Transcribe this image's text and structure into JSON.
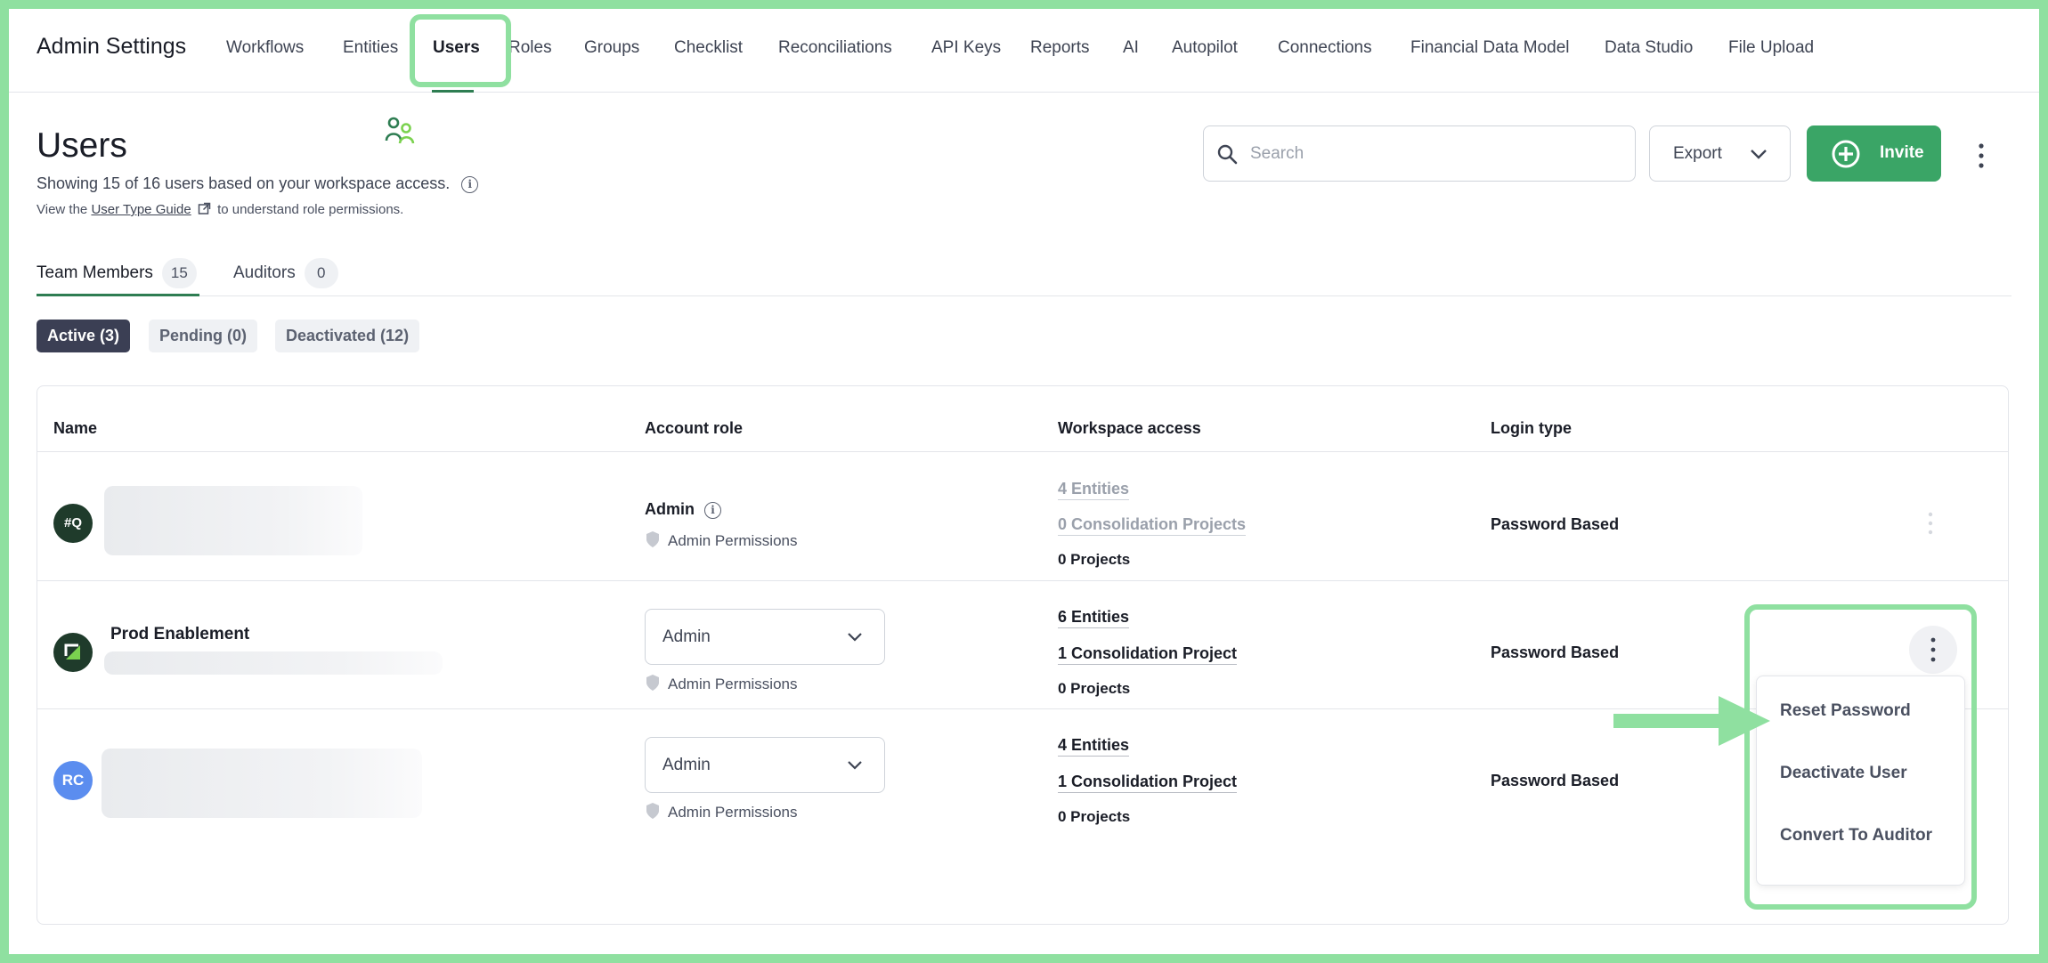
{
  "app": {
    "title": "Admin Settings"
  },
  "nav": {
    "tabs": [
      {
        "label": "Workflows"
      },
      {
        "label": "Entities"
      },
      {
        "label": "Users",
        "active": true
      },
      {
        "label": "Roles"
      },
      {
        "label": "Groups"
      },
      {
        "label": "Checklist"
      },
      {
        "label": "Reconciliations"
      },
      {
        "label": "API Keys"
      },
      {
        "label": "Reports"
      },
      {
        "label": "AI"
      },
      {
        "label": "Autopilot"
      },
      {
        "label": "Connections"
      },
      {
        "label": "Financial Data Model"
      },
      {
        "label": "Data Studio"
      },
      {
        "label": "File Upload"
      }
    ]
  },
  "page": {
    "title": "Users",
    "subtitle": "Showing 15 of 16 users based on your workspace access.",
    "guide_prefix": "View the",
    "guide_link": "User Type Guide",
    "guide_suffix": "to understand role permissions."
  },
  "search": {
    "placeholder": "Search",
    "value": ""
  },
  "actions": {
    "export_label": "Export",
    "invite_label": "Invite"
  },
  "tabs": [
    {
      "label": "Team Members",
      "count": "15",
      "active": true
    },
    {
      "label": "Auditors",
      "count": "0"
    }
  ],
  "filters": [
    {
      "label": "Active (3)",
      "active": true
    },
    {
      "label": "Pending (0)"
    },
    {
      "label": "Deactivated (12)"
    }
  ],
  "table": {
    "headers": {
      "name": "Name",
      "role": "Account role",
      "workspace": "Workspace access",
      "login": "Login type"
    },
    "rows": [
      {
        "avatar": "#Q",
        "avatar_color": "#1f3b2b",
        "name": "",
        "role": "Admin",
        "permissions": "Admin Permissions",
        "entities": "4 Entities",
        "consolidation": "0 Consolidation Projects",
        "projects": "0 Projects",
        "login": "Password Based"
      },
      {
        "avatar": "",
        "avatar_color": "#1f3b2b",
        "name": "Prod Enablement",
        "role": "Admin",
        "permissions": "Admin Permissions",
        "entities": "6 Entities",
        "consolidation": "1 Consolidation Project",
        "projects": "0 Projects",
        "login": "Password Based"
      },
      {
        "avatar": "RC",
        "avatar_color": "#5b8def",
        "name": "",
        "role": "Admin",
        "permissions": "Admin Permissions",
        "entities": "4 Entities",
        "consolidation": "1 Consolidation Project",
        "projects": "0 Projects",
        "login": "Password Based"
      }
    ]
  },
  "row_menu": {
    "items": [
      {
        "label": "Reset Password"
      },
      {
        "label": "Deactivate User"
      },
      {
        "label": "Convert To Auditor"
      }
    ]
  },
  "colors": {
    "accent": "#3aa566",
    "highlight": "#8fe0a0",
    "active_chip": "#3b3f54"
  }
}
